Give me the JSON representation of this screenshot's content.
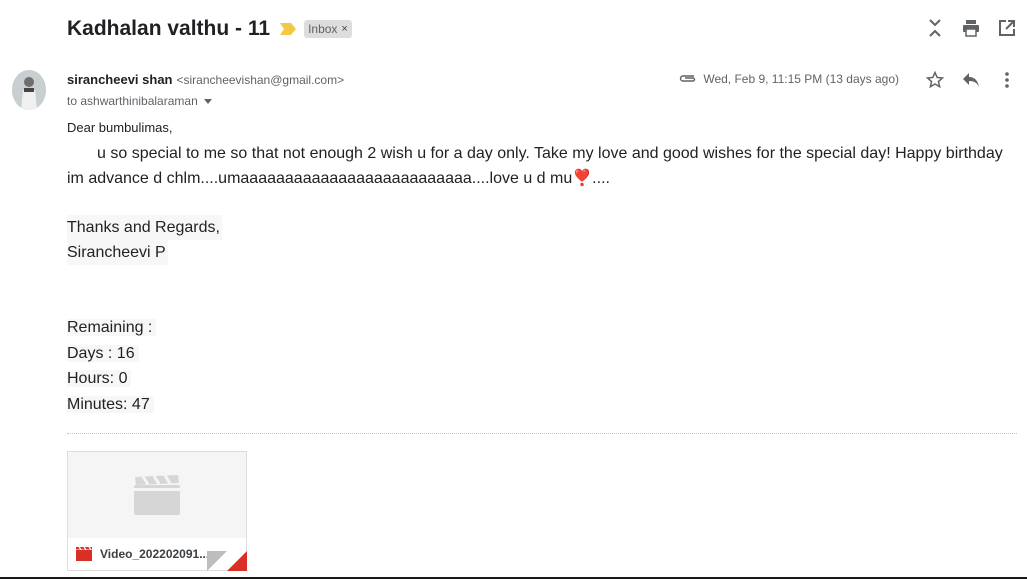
{
  "subject": "Kadhalan valthu - 11",
  "label": {
    "name": "Inbox",
    "remove": "×"
  },
  "sender": {
    "name": "sirancheevi shan",
    "email": "<sirancheevishan@gmail.com>"
  },
  "recipient": "to ashwarthinibalaraman",
  "date": "Wed, Feb 9, 11:15 PM (13 days ago)",
  "body": {
    "greeting": "Dear bumbulimas,",
    "paragraph": "u  so special to me so that not enough 2 wish u for a day only. Take my love and good wishes for the special day! Happy birthday im advance d chlm....umaaaaaaaaaaaaaaaaaaaaaaaaaa....love u d mu❣️....",
    "sign_off": [
      "Thanks and Regards,",
      "Sirancheevi P"
    ],
    "remaining": [
      "Remaining :",
      "Days : 16",
      "Hours: 0",
      "Minutes: 47"
    ]
  },
  "attachment": {
    "name": "Video_202202091..."
  },
  "icons": {
    "importance": "importance-marker-icon",
    "collapse": "collapse-all-icon",
    "print": "print-icon",
    "open_new": "open-in-new-window-icon",
    "attachment": "paperclip-icon",
    "star": "star-icon",
    "reply": "reply-icon",
    "more": "more-vert-icon",
    "video": "video-file-icon"
  },
  "colors": {
    "importance": "#f4c842",
    "video_badge": "#d93025",
    "chip_bg": "#dddddd"
  }
}
